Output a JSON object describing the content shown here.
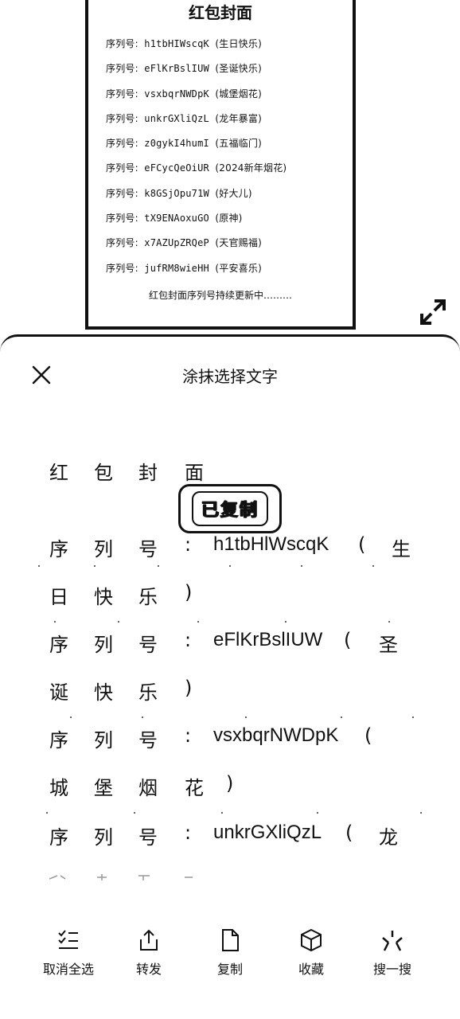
{
  "card": {
    "title": "红包封面",
    "rows": [
      {
        "label": "序列号:",
        "code": "h1tbHIWscqK",
        "note": "(生日快乐)"
      },
      {
        "label": "序列号:",
        "code": "eFlKrBslIUW",
        "note": "(圣诞快乐)"
      },
      {
        "label": "序列号:",
        "code": "vsxbqrNWDpK",
        "note": "(城堡烟花)"
      },
      {
        "label": "序列号:",
        "code": "unkrGXliQzL",
        "note": "(龙年暴富)"
      },
      {
        "label": "序列号:",
        "code": "z0gykI4humI",
        "note": "(五福临门)"
      },
      {
        "label": "序列号:",
        "code": "eFCycQeOiUR",
        "note": "(2024新年烟花)"
      },
      {
        "label": "序列号:",
        "code": "k8GSjOpu71W",
        "note": "(好大儿)"
      },
      {
        "label": "序列号:",
        "code": "tX9ENAoxuGO",
        "note": "(原神)"
      },
      {
        "label": "序列号:",
        "code": "x7AZUpZRQeP",
        "note": "(天官赐福)"
      },
      {
        "label": "序列号:",
        "code": "jufRM8wieHH",
        "note": "(平安喜乐)"
      }
    ],
    "footer": "红包封面序列号持续更新中………"
  },
  "sheet": {
    "title": "涂抹选择文字",
    "toast": "已复制",
    "heading_chars": [
      "红",
      "包",
      "封",
      "面"
    ],
    "label_chars": [
      "序",
      "列",
      "号",
      ":"
    ],
    "entries": [
      {
        "code": "h1tbHlWscqK",
        "line1_tail": [
          "(",
          "生"
        ],
        "line2": [
          "日",
          "快",
          "乐",
          ")"
        ]
      },
      {
        "code": "eFlKrBslIUW",
        "line1_tail": [
          "(",
          "圣"
        ],
        "line2": [
          "诞",
          "快",
          "乐",
          ")"
        ]
      },
      {
        "code": "vsxbqrNWDpK",
        "line1_tail": [
          "("
        ],
        "line2": [
          "城",
          "堡",
          "烟",
          "花",
          ")"
        ]
      },
      {
        "code": "unkrGXliQzL",
        "line1_tail": [
          "(",
          "龙"
        ],
        "line2": []
      }
    ]
  },
  "toolbar": {
    "items": [
      {
        "label": "取消全选",
        "icon": "checklist-icon"
      },
      {
        "label": "转发",
        "icon": "share-icon"
      },
      {
        "label": "复制",
        "icon": "document-icon"
      },
      {
        "label": "收藏",
        "icon": "cube-icon"
      },
      {
        "label": "搜一搜",
        "icon": "search-spark-icon"
      }
    ]
  }
}
